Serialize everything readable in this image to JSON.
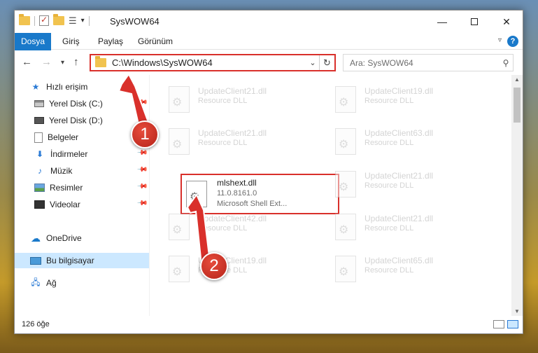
{
  "window": {
    "title": "SysWOW64",
    "min_glyph": "—",
    "close_glyph": "✕"
  },
  "ribbon": {
    "tabs": [
      "Dosya",
      "Giriş",
      "Paylaş",
      "Görünüm"
    ],
    "help": "?"
  },
  "address": {
    "path": "C:\\Windows\\SysWOW64",
    "search_placeholder": "Ara: SysWOW64"
  },
  "sidebar": {
    "items": [
      {
        "label": "Hızlı erişim",
        "icon": "star-icon"
      },
      {
        "label": "Yerel Disk (C:)",
        "icon": "drive-icon",
        "pinned": true
      },
      {
        "label": "Yerel Disk (D:)",
        "icon": "drive-icon"
      },
      {
        "label": "Belgeler",
        "icon": "documents-icon"
      },
      {
        "label": "İndirmeler",
        "icon": "downloads-icon",
        "pinned": true
      },
      {
        "label": "Müzik",
        "icon": "music-icon",
        "pinned": true
      },
      {
        "label": "Resimler",
        "icon": "pictures-icon",
        "pinned": true
      },
      {
        "label": "Videolar",
        "icon": "videos-icon",
        "pinned": true
      },
      {
        "label": "OneDrive",
        "icon": "onedrive-icon"
      },
      {
        "label": "Bu bilgisayar",
        "icon": "computer-icon",
        "selected": true
      },
      {
        "label": "Ağ",
        "icon": "network-icon"
      }
    ]
  },
  "files": {
    "left": [
      {
        "name": "UpdateClient21.dll",
        "type": "Resource DLL"
      },
      {
        "name": "UpdateClient21.dll",
        "type": "Resource DLL"
      },
      {
        "name": "mlshext.dll",
        "version": "11.0.8161.0",
        "desc": "Microsoft Shell Ext..."
      },
      {
        "name": "UpdateClient42.dll",
        "type": "Resource DLL"
      },
      {
        "name": "UpdateClient19.dll",
        "type": "Resource DLL"
      }
    ],
    "right": [
      {
        "name": "UpdateClient19.dll",
        "type": "Resource DLL"
      },
      {
        "name": "UpdateClient63.dll",
        "type": "Resource DLL"
      },
      {
        "name": "UpdateClient21.dll",
        "type": "Resource DLL"
      },
      {
        "name": "UpdateClient21.dll",
        "type": "Resource DLL"
      },
      {
        "name": "UpdateClient65.dll",
        "type": "Resource DLL"
      }
    ]
  },
  "status": {
    "item_count": "126 öğe"
  },
  "annotations": {
    "step1": "1",
    "step2": "2",
    "color": "#d9302b"
  }
}
